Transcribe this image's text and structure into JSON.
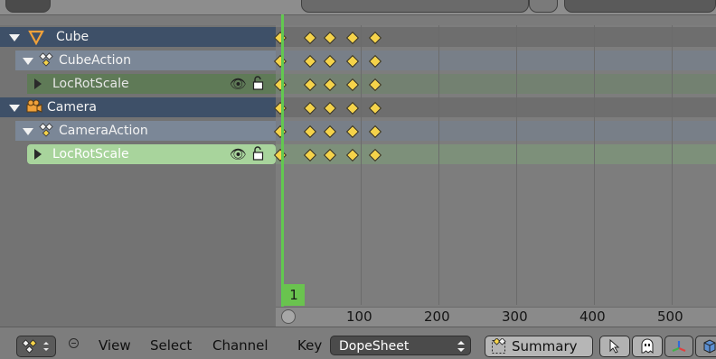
{
  "channels": [
    {
      "label": "Cube",
      "icon": "cube-object-icon"
    },
    {
      "label": "CubeAction",
      "icon": "action-icon"
    },
    {
      "label": "LocRotScale",
      "icon": "fcurve-group-icon"
    },
    {
      "label": "Camera",
      "icon": "camera-object-icon"
    },
    {
      "label": "CameraAction",
      "icon": "action-icon"
    },
    {
      "label": "LocRotScale",
      "icon": "fcurve-group-icon"
    }
  ],
  "timeline": {
    "current_frame": "1",
    "ruler_ticks": [
      "100",
      "200",
      "300",
      "400",
      "500"
    ]
  },
  "header": {
    "menu": [
      "View",
      "Select",
      "Channel",
      "Key"
    ],
    "mode": "DopeSheet",
    "summary": "Summary"
  },
  "colors": {
    "object_row": "#3e5068",
    "action_row": "#7b8797",
    "group_row": "#5f7a57",
    "selected_group_row": "#a8d49c",
    "playhead": "#62c850",
    "keyframe": "#f5d34a"
  }
}
